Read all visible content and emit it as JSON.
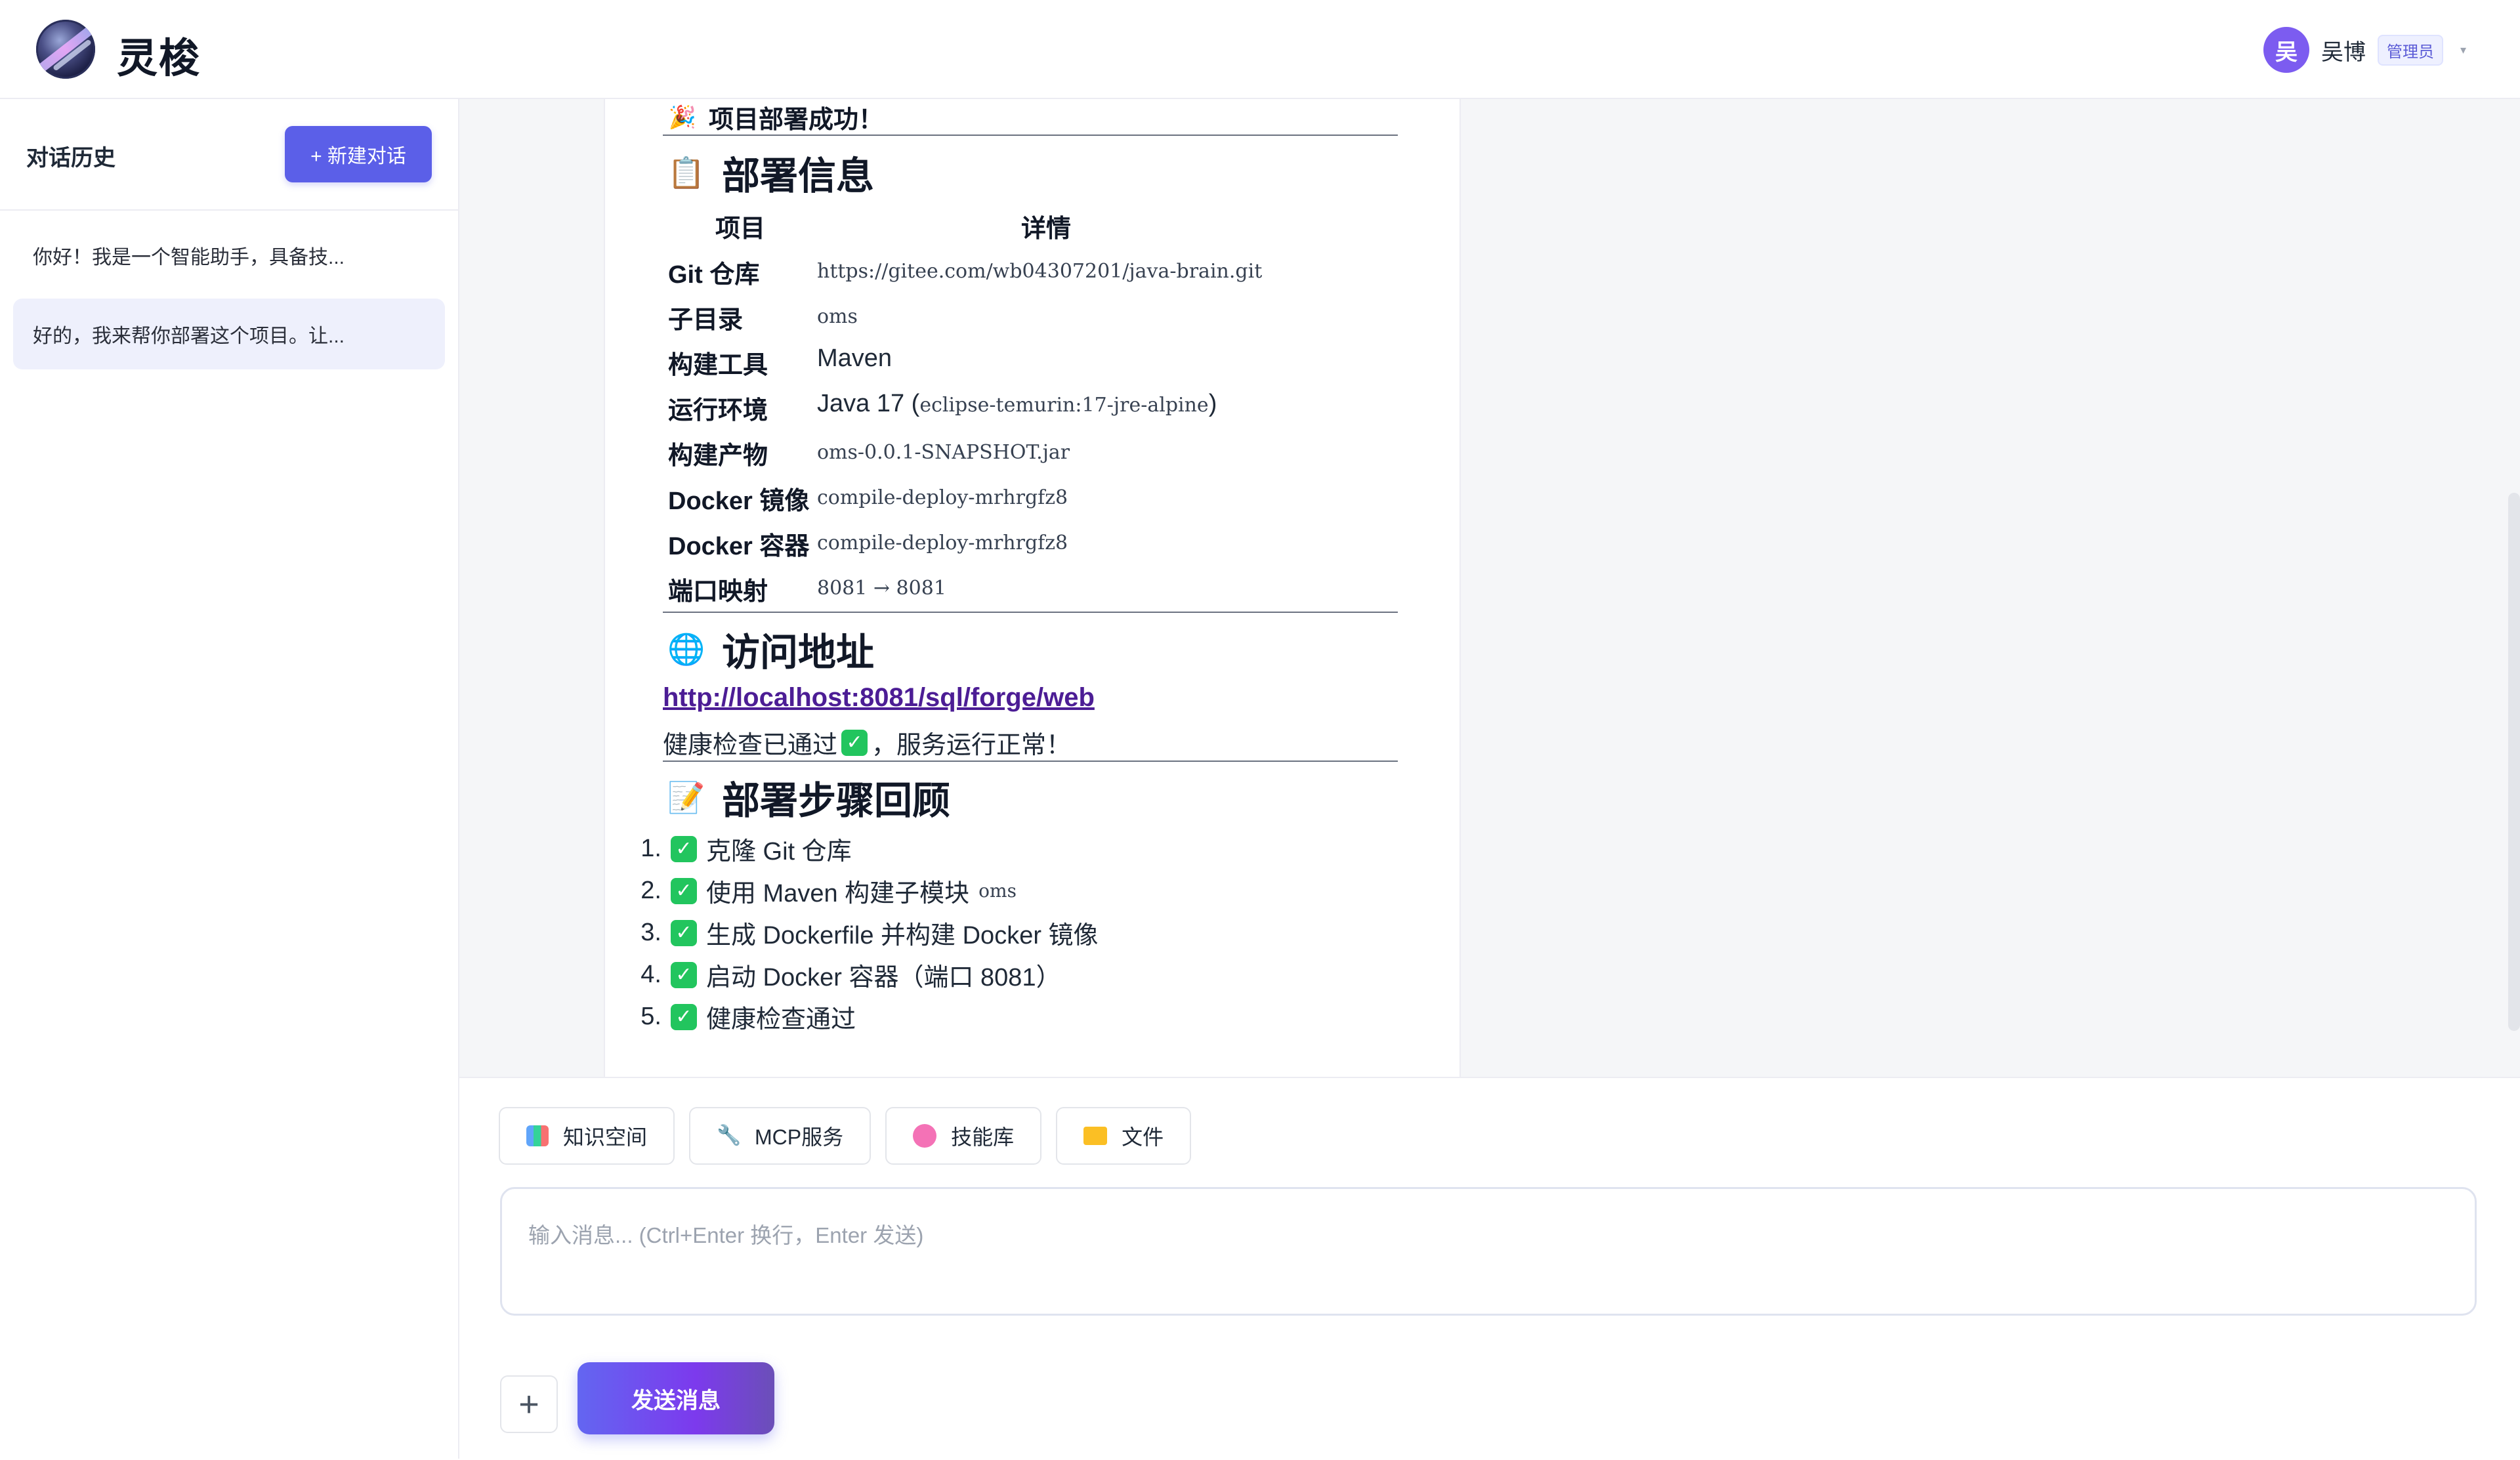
{
  "app": {
    "title": "灵梭"
  },
  "user": {
    "avatar_initial": "吴",
    "name": "吴博",
    "role": "管理员"
  },
  "sidebar": {
    "title": "对话历史",
    "new_chat_label": "+ 新建对话",
    "history": [
      {
        "label": "你好！我是一个智能助手，具备技..."
      },
      {
        "label": "好的，我来帮你部署这个项目。让..."
      }
    ]
  },
  "message": {
    "success_line": "项目部署成功！",
    "deploy_heading": "部署信息",
    "table_headers": [
      "项目",
      "详情"
    ],
    "rows": [
      {
        "key": "Git 仓库",
        "value": "https://gitee.com/wb04307201/java-brain.git"
      },
      {
        "key": "子目录",
        "value": "oms"
      },
      {
        "key": "构建工具",
        "value": "Maven"
      },
      {
        "key": "运行环境",
        "value_prefix": "Java 17 (",
        "value_code": "eclipse-temurin:17-jre-alpine",
        "value_suffix": ")"
      },
      {
        "key": "构建产物",
        "value": "oms-0.0.1-SNAPSHOT.jar"
      },
      {
        "key": "Docker 镜像",
        "value": "compile-deploy-mrhrgfz8"
      },
      {
        "key": "Docker 容器",
        "value": "compile-deploy-mrhrgfz8"
      },
      {
        "key": "端口映射",
        "value": "8081 → 8081"
      }
    ],
    "access_heading": "访问地址",
    "access_url": "http://localhost:8081/sql/forge/web",
    "health_before": "健康检查已通过",
    "health_after": "，服务运行正常！",
    "steps_heading": "部署步骤回顾",
    "steps": [
      {
        "num": "1.",
        "text": "克隆 Git 仓库"
      },
      {
        "num": "2.",
        "text": "使用 Maven 构建子模块",
        "code": "oms"
      },
      {
        "num": "3.",
        "text": "生成 Dockerfile 并构建 Docker 镜像"
      },
      {
        "num": "4.",
        "text": "启动 Docker 容器（端口 8081）"
      },
      {
        "num": "5.",
        "text": "健康检查通过"
      }
    ]
  },
  "composer": {
    "chips": [
      {
        "label": "知识空间",
        "icon": "books-icon"
      },
      {
        "label": "MCP服务",
        "icon": "wrench-icon"
      },
      {
        "label": "技能库",
        "icon": "brain-icon"
      },
      {
        "label": "文件",
        "icon": "folder-icon"
      }
    ],
    "placeholder": "输入消息... (Ctrl+Enter 换行，Enter 发送)",
    "value": "",
    "send_label": "发送消息"
  },
  "colors": {
    "accent": "#5b5fe8",
    "link": "#4c1d95",
    "check": "#22c55e"
  }
}
